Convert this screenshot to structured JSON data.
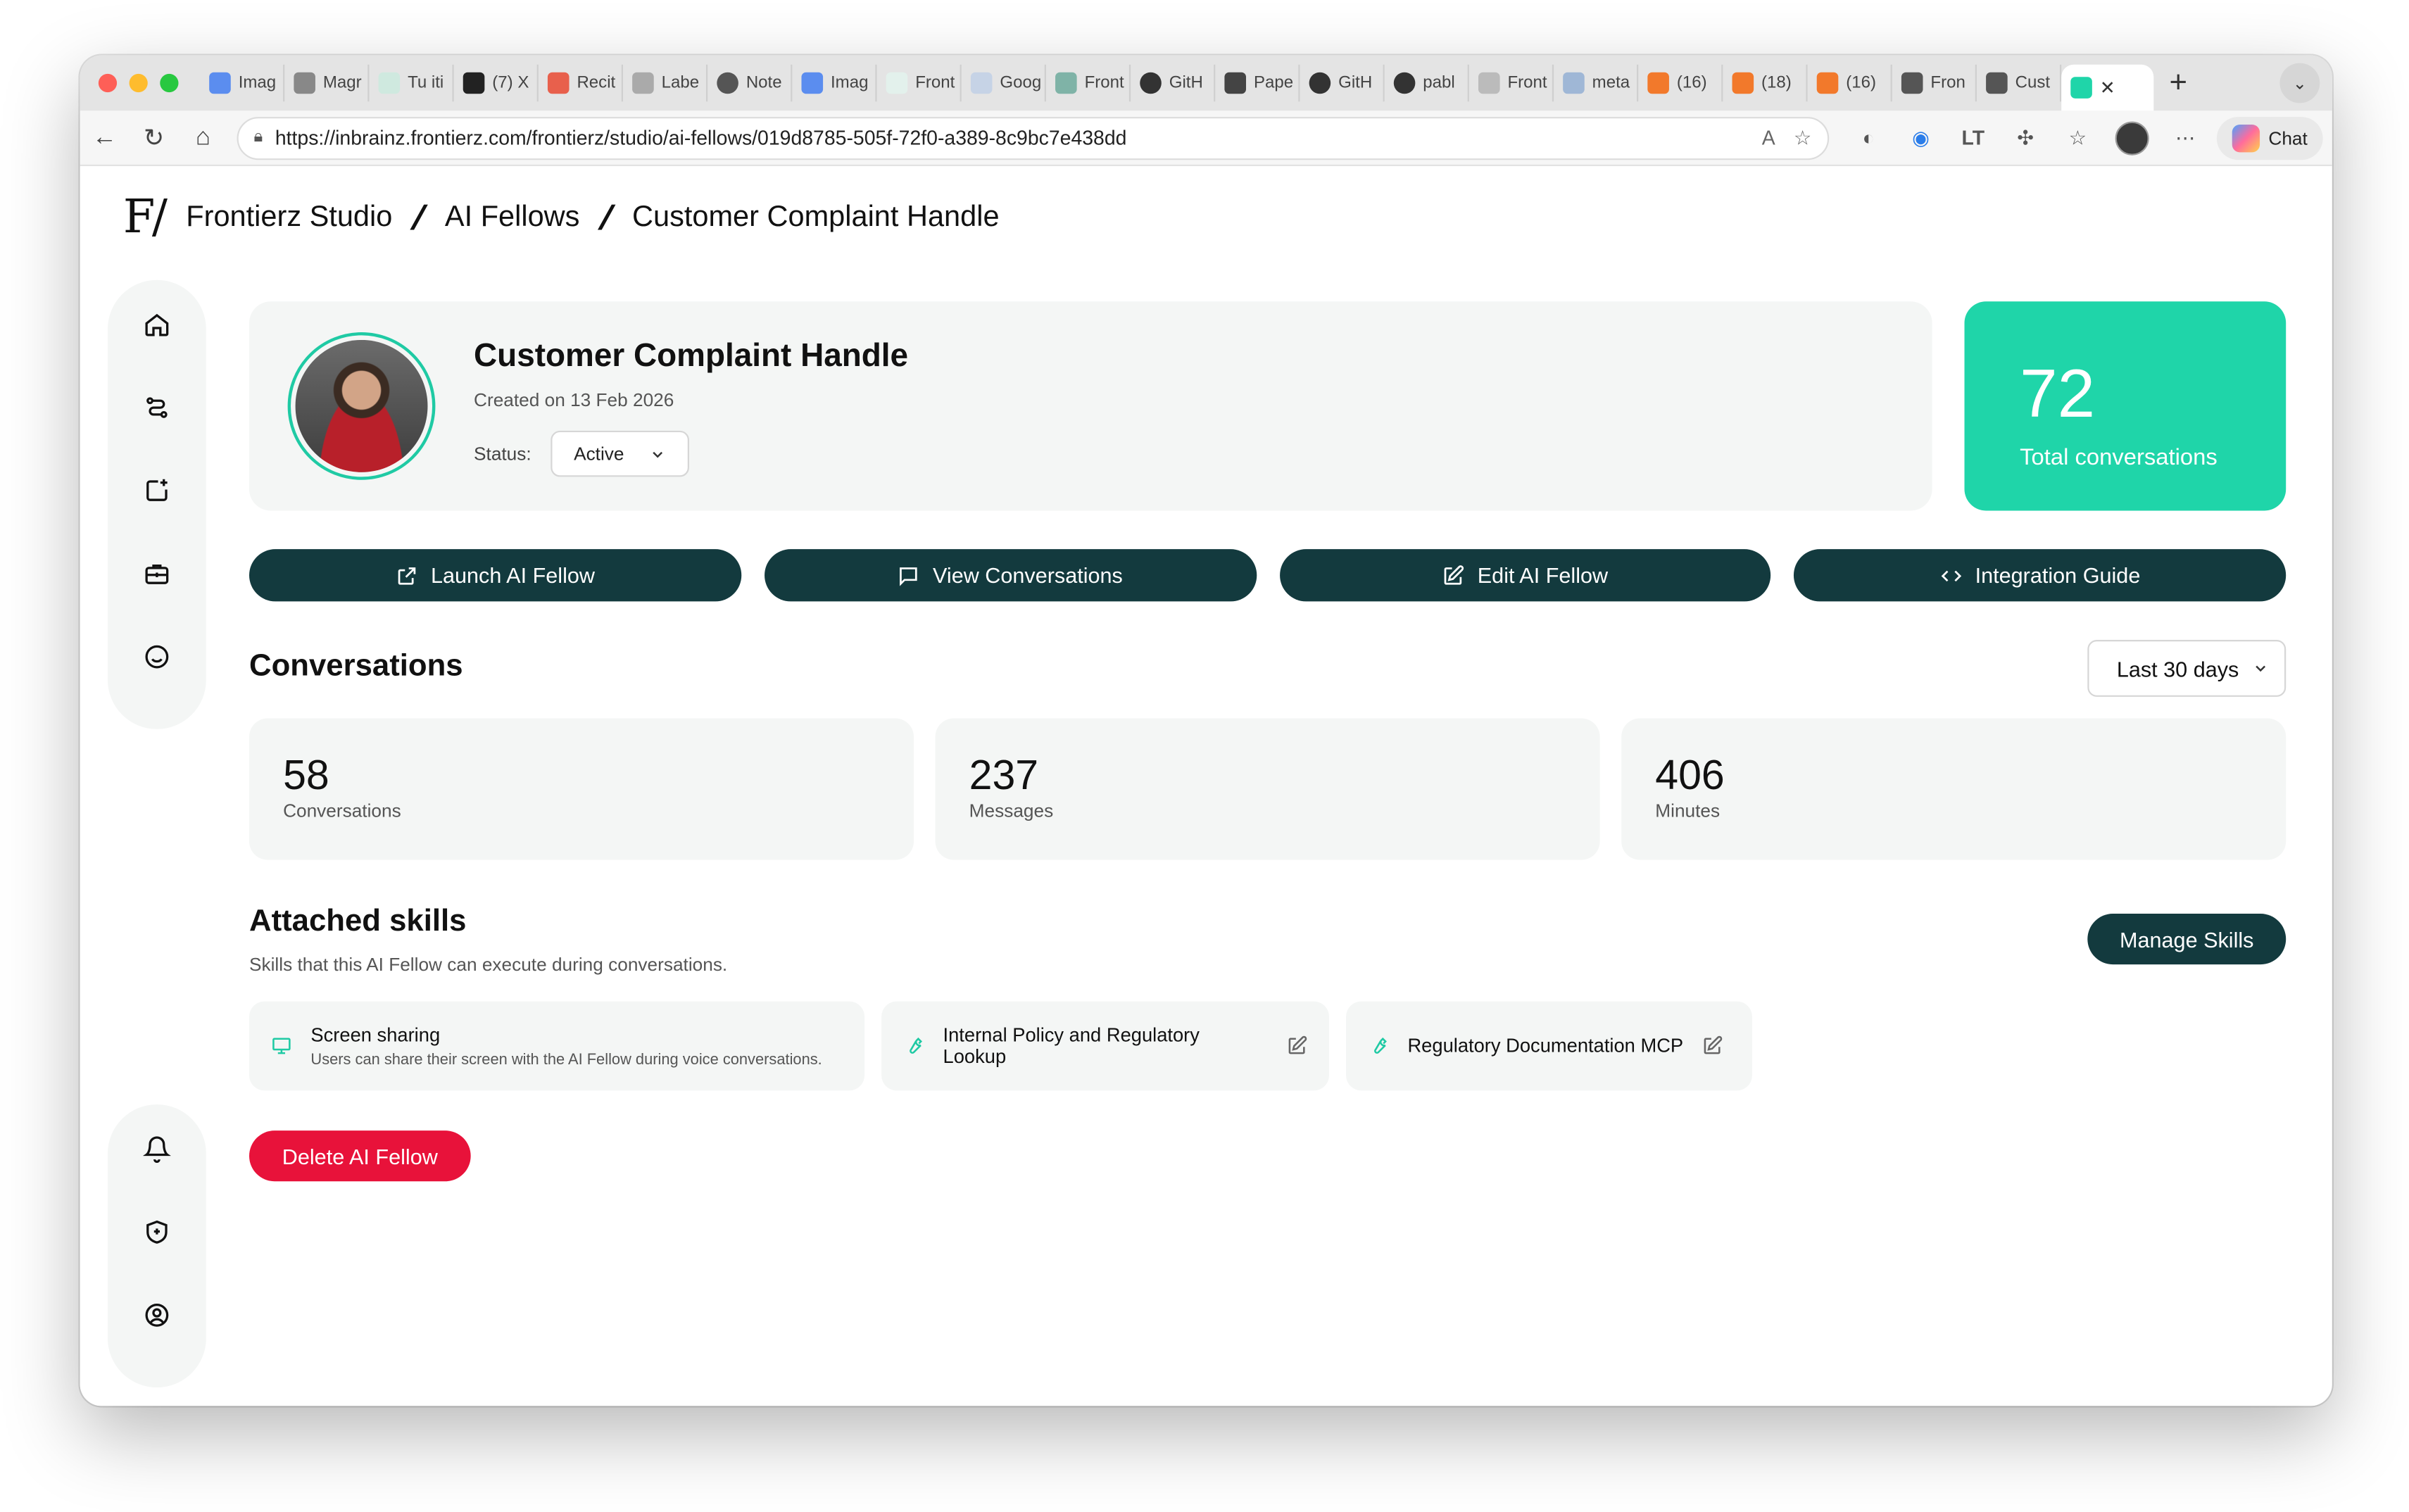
{
  "browser": {
    "tabs": [
      {
        "label": "Imag"
      },
      {
        "label": "Magr"
      },
      {
        "label": "Tu iti"
      },
      {
        "label": "(7) X"
      },
      {
        "label": "Recit"
      },
      {
        "label": "Labe"
      },
      {
        "label": "Note"
      },
      {
        "label": "Imag"
      },
      {
        "label": "Front"
      },
      {
        "label": "Goog"
      },
      {
        "label": "Front"
      },
      {
        "label": "GitH"
      },
      {
        "label": "Pape"
      },
      {
        "label": "GitH"
      },
      {
        "label": "pabl"
      },
      {
        "label": "Front"
      },
      {
        "label": "meta"
      },
      {
        "label": "(16)"
      },
      {
        "label": "(18)"
      },
      {
        "label": "(16)"
      },
      {
        "label": "Fron"
      },
      {
        "label": "Cust"
      }
    ],
    "url": "https://inbrainz.frontierz.com/frontierz/studio/ai-fellows/019d8785-505f-72f0-a389-8c9bc7e438dd",
    "chat_label": "Chat"
  },
  "breadcrumb": {
    "logo": "F/",
    "items": [
      "Frontierz Studio",
      "AI Fellows",
      "Customer Complaint Handle"
    ]
  },
  "profile": {
    "name": "Customer Complaint Handle",
    "created": "Created on 13 Feb 2026",
    "status_label": "Status:",
    "status_value": "Active"
  },
  "total": {
    "value": "72",
    "label": "Total conversations"
  },
  "actions": {
    "launch": "Launch AI Fellow",
    "view": "View Conversations",
    "edit": "Edit AI Fellow",
    "integration": "Integration Guide"
  },
  "conversations": {
    "title": "Conversations",
    "range": "Last 30 days",
    "metrics": [
      {
        "value": "58",
        "label": "Conversations"
      },
      {
        "value": "237",
        "label": "Messages"
      },
      {
        "value": "406",
        "label": "Minutes"
      }
    ]
  },
  "skills": {
    "title": "Attached skills",
    "subtitle": "Skills that this AI Fellow can execute during conversations.",
    "manage_label": "Manage Skills",
    "items": [
      {
        "title": "Screen sharing",
        "desc": "Users can share their screen with the AI Fellow during voice conversations."
      },
      {
        "title": "Internal Policy and Regulatory Lookup"
      },
      {
        "title": "Regulatory Documentation MCP"
      }
    ]
  },
  "delete_label": "Delete AI Fellow",
  "colors": {
    "accent": "#1fd5a9",
    "primary_button": "#133a3e",
    "danger": "#e8123a",
    "card_bg": "#f4f6f5"
  }
}
